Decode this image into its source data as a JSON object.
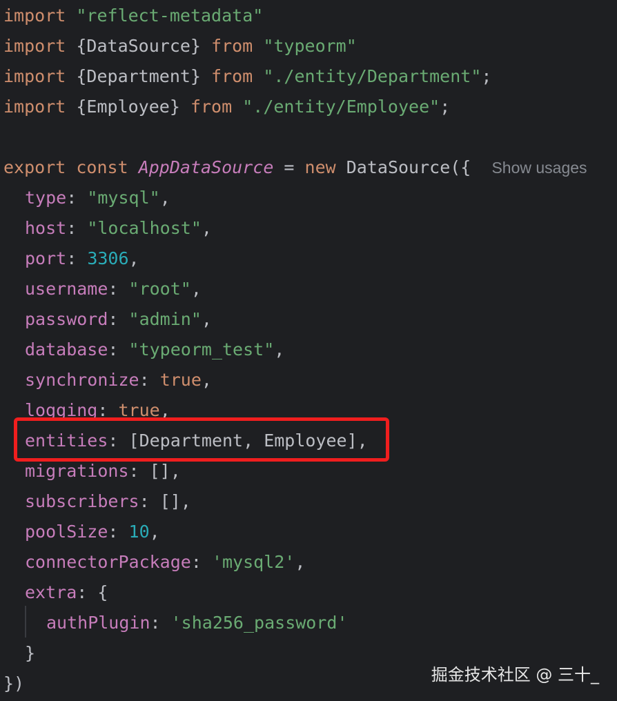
{
  "code": {
    "imports": [
      {
        "kw": "import",
        "text": " ",
        "module": "\"reflect-metadata\""
      },
      {
        "kw": "import",
        "text": " {DataSource} ",
        "from": "from",
        "module": "\"typeorm\""
      },
      {
        "kw": "import",
        "text": " {Department} ",
        "from": "from",
        "module": "\"./entity/Department\"",
        "end": ";"
      },
      {
        "kw": "import",
        "text": " {Employee} ",
        "from": "from",
        "module": "\"./entity/Employee\"",
        "end": ";"
      }
    ],
    "export_kw": "export",
    "const_kw": "const",
    "var_name": "AppDataSource",
    "equals": " = ",
    "new_kw": "new",
    "ctor": " DataSource({",
    "hint": "Show usages",
    "props": {
      "type": {
        "key": "type",
        "value": "\"mysql\""
      },
      "host": {
        "key": "host",
        "value": "\"localhost\""
      },
      "port": {
        "key": "port",
        "value": "3306"
      },
      "username": {
        "key": "username",
        "value": "\"root\""
      },
      "password": {
        "key": "password",
        "value": "\"admin\""
      },
      "database": {
        "key": "database",
        "value": "\"typeorm_test\""
      },
      "synchronize": {
        "key": "synchronize",
        "value": "true"
      },
      "logging": {
        "key": "logging",
        "value": "true"
      },
      "entities": {
        "key": "entities",
        "value": "[Department, Employee]"
      },
      "migrations": {
        "key": "migrations",
        "value": "[]"
      },
      "subscribers": {
        "key": "subscribers",
        "value": "[]"
      },
      "poolSize": {
        "key": "poolSize",
        "value": "10"
      },
      "connectorPackage": {
        "key": "connectorPackage",
        "value": "'mysql2'"
      },
      "extra": {
        "key": "extra",
        "value": "{"
      },
      "authPlugin": {
        "key": "authPlugin",
        "value": "'sha256_password'"
      }
    },
    "close_extra": "}",
    "close_all": "})"
  },
  "watermark": "掘金技术社区 @ 三十_",
  "colors": {
    "background": "#1e1f22",
    "keyword": "#cf8e6d",
    "string": "#6aab73",
    "number": "#2aacb8",
    "property": "#c77dbb",
    "highlight_border": "#f01e1e"
  }
}
